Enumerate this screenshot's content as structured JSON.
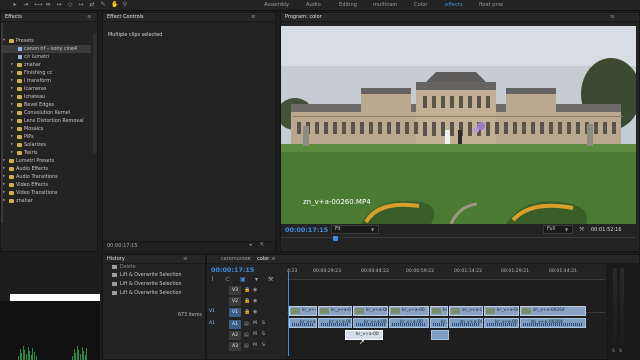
{
  "workspaces": [
    {
      "label": "Assembly",
      "active": false
    },
    {
      "label": "Audio",
      "active": false
    },
    {
      "label": "Editing",
      "active": false
    },
    {
      "label": "multicam",
      "active": false
    },
    {
      "label": "Color",
      "active": false
    },
    {
      "label": "effects",
      "active": true
    },
    {
      "label": "float pnw",
      "active": false
    }
  ],
  "effects_panel": {
    "title": "Effects",
    "items": [
      {
        "label": "Presets",
        "type": "folder",
        "depth": 0,
        "open": true
      },
      {
        "label": "canon nf – sony cine4",
        "type": "preset",
        "depth": 1,
        "open": false,
        "selected": true
      },
      {
        "label": "c/r lumetri",
        "type": "preset",
        "depth": 1,
        "open": false
      },
      {
        "label": "znahar",
        "type": "folder",
        "depth": 1,
        "open": false
      },
      {
        "label": "Finishing cc",
        "type": "folder",
        "depth": 1,
        "open": false
      },
      {
        "label": "I transform",
        "type": "folder",
        "depth": 1,
        "open": false
      },
      {
        "label": "Icameras",
        "type": "folder",
        "depth": 1,
        "open": false
      },
      {
        "label": "Ichateau",
        "type": "folder",
        "depth": 1,
        "open": false
      },
      {
        "label": "Bevel Edges",
        "type": "folder",
        "depth": 1,
        "open": false
      },
      {
        "label": "Convolution Kernel",
        "type": "folder",
        "depth": 1,
        "open": false
      },
      {
        "label": "Lens Distortion Removal",
        "type": "folder",
        "depth": 1,
        "open": false
      },
      {
        "label": "Mosaics",
        "type": "folder",
        "depth": 1,
        "open": false
      },
      {
        "label": "PiPs",
        "type": "folder",
        "depth": 1,
        "open": false
      },
      {
        "label": "Solarizes",
        "type": "folder",
        "depth": 1,
        "open": false
      },
      {
        "label": "Twirls",
        "type": "folder",
        "depth": 1,
        "open": false
      },
      {
        "label": "Lumetri Presets",
        "type": "folder",
        "depth": 0,
        "open": false
      },
      {
        "label": "Audio Effects",
        "type": "folder",
        "depth": 0,
        "open": false
      },
      {
        "label": "Audio Transitions",
        "type": "folder",
        "depth": 0,
        "open": false
      },
      {
        "label": "Video Effects",
        "type": "folder",
        "depth": 0,
        "open": false
      },
      {
        "label": "Video Transitions",
        "type": "folder",
        "depth": 0,
        "open": false
      },
      {
        "label": "znahar",
        "type": "folder",
        "depth": 0,
        "open": false
      }
    ]
  },
  "effect_controls": {
    "title": "Effect Controls",
    "message": "Multiple clips selected",
    "timecode": "00:00:17:15"
  },
  "program": {
    "title": "Program: color",
    "clip_name": "zn_v+a-00260.MP4",
    "timecode": "00:00:17:15",
    "fit": "Fit",
    "quality": "Full",
    "duration": "00:01:52:16"
  },
  "history": {
    "title": "History",
    "items": [
      "Delete",
      "Lift & Overwrite Selection",
      "Lift & Overwrite Selection",
      "Lift & Overwrite Selection"
    ],
    "count": "673 items"
  },
  "timeline": {
    "tabs": [
      {
        "label": "ceremonies",
        "active": false
      },
      {
        "label": "color",
        "active": true
      }
    ],
    "timecode": "00:00:17:15",
    "ruler": [
      "4:23",
      "00:00:29:23",
      "00:00:44:22",
      "00:00:59:22",
      "00:01:14:22",
      "00:01:29:21",
      "00:01:44:21"
    ],
    "tracks": [
      {
        "id": "V3",
        "source": "",
        "toggle": "",
        "mute": "",
        "solo": ""
      },
      {
        "id": "V2",
        "source": "",
        "toggle": "",
        "mute": "",
        "solo": ""
      },
      {
        "id": "V1",
        "source": "V1",
        "toggle": "",
        "mute": "",
        "solo": ""
      },
      {
        "id": "A1",
        "source": "A1",
        "toggle": "",
        "mute": "M",
        "solo": "S"
      },
      {
        "id": "A2",
        "source": "",
        "toggle": "",
        "mute": "M",
        "solo": "S"
      },
      {
        "id": "A3",
        "source": "",
        "toggle": "",
        "mute": "M",
        "solo": "S"
      }
    ],
    "video_clip_label": "kr_v+a-00",
    "audio_clip_label": "kr_v+a-00",
    "video_clips": [
      "kr_v+a-00",
      "kr_v+a-00",
      "kr_v+a-00",
      "kr_v+a-00",
      "kr_v+a-00",
      "zn_v+a-00",
      "kr_v+a-00",
      "zn_v+a-00264"
    ],
    "audio_clips": [
      "kr_v+a-00",
      "kr_v+a-00",
      "kr_v+a-00",
      "kr_v+a-00",
      "kr_v+a-00",
      "zn_v+a-00",
      "kr_v+a-00",
      "zn_v+a-00264"
    ],
    "meter_labels": [
      "S",
      "S"
    ]
  },
  "colors": {
    "accent": "#3f8fe3",
    "clip_video": "#8ba2c6",
    "clip_audio": "#7d9dc3",
    "grass": "#4b7a33"
  }
}
